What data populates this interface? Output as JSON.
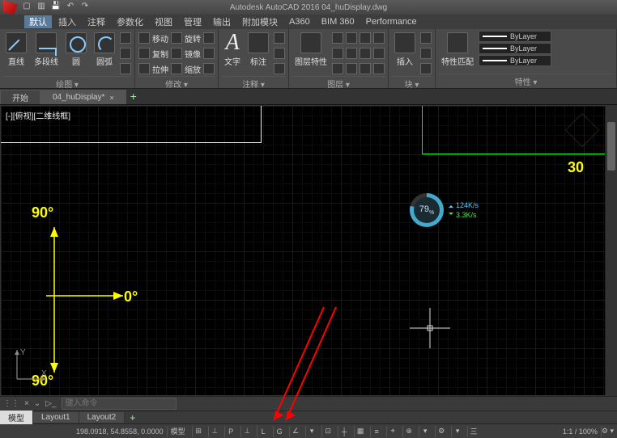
{
  "app": {
    "title": "Autodesk AutoCAD 2016   04_huDisplay.dwg"
  },
  "menu": {
    "items": [
      "默认",
      "插入",
      "注释",
      "参数化",
      "视图",
      "管理",
      "输出",
      "附加模块",
      "A360",
      "BIM 360",
      "Performance"
    ],
    "active_index": 0
  },
  "ribbon": {
    "draw": {
      "label": "绘图 ▾",
      "line": "直线",
      "polyline": "多段线",
      "circle": "圆",
      "arc": "圆弧"
    },
    "modify": {
      "label": "修改 ▾",
      "move": "移动",
      "rotate": "旋转",
      "copy": "复制",
      "mirror": "镜像",
      "stretch": "拉伸",
      "scale": "缩放"
    },
    "annot": {
      "label": "注释 ▾",
      "text": "文字",
      "dim": "标注"
    },
    "layers": {
      "label": "图层 ▾",
      "btn": "图层特性"
    },
    "block": {
      "label": "块 ▾",
      "insert": "插入"
    },
    "props": {
      "label": "特性 ▾",
      "btn": "特性匹配",
      "bylayer": "ByLayer"
    }
  },
  "tabs": {
    "start": "开始",
    "file": "04_huDisplay*",
    "close_glyph": "×"
  },
  "view": {
    "label": "[-][俯视][二维线框]"
  },
  "drawing": {
    "angle_top": "90°",
    "angle_right": "0°",
    "angle_bottom": "90°",
    "label_30": "30",
    "ucs_x": "X",
    "ucs_y": "Y"
  },
  "perf": {
    "pct": "79",
    "pct_suffix": "%",
    "up": "124K/s",
    "down": "3.3K/s"
  },
  "cmd": {
    "placeholder": "键入命令",
    "close": "×"
  },
  "layouts": {
    "model": "模型",
    "l1": "Layout1",
    "l2": "Layout2"
  },
  "status": {
    "coords": "198.0918, 54.8558, 0.0000",
    "space": "模型",
    "btns": [
      "⊞",
      "⊥",
      "P",
      "⊥",
      "L",
      "G",
      "∠",
      "▾",
      "⊡",
      "┼",
      "▦",
      "≡",
      "⌖",
      "⊕",
      "▾",
      "⚙",
      "▾",
      "三"
    ],
    "zoom": "1:1 / 100%",
    "extra": "⚙ ▾"
  }
}
